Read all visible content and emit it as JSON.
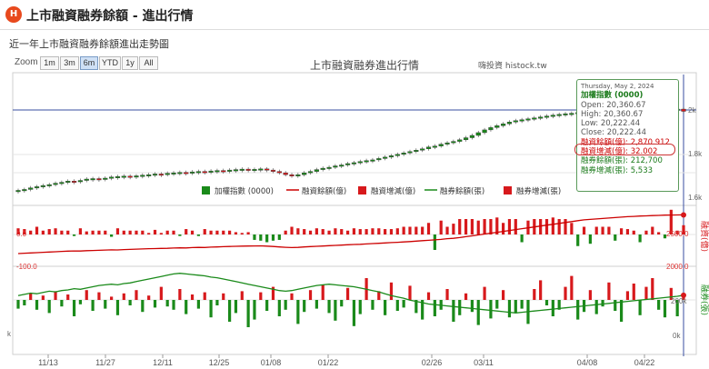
{
  "header": {
    "logo_text": "H",
    "title": "上市融資融券餘額 - 進出行情"
  },
  "subtitle": "近一年上市融資融券餘額進出走勢圖",
  "zoom": {
    "label": "Zoom",
    "buttons": [
      "1m",
      "3m",
      "6m",
      "YTD",
      "1y",
      "All"
    ],
    "active": "6m"
  },
  "chart_title": "上市融資融券進出行情",
  "credit": "嗨投資 histock.tw",
  "colors": {
    "up": "#d7191c",
    "down": "#1a8a1a",
    "margin_line": "#cc0000",
    "short_line": "#1a8a1a",
    "grid": "#e6e6e6",
    "axis": "#cfcfcf",
    "nav": "#3a4fa0"
  },
  "tooltip": {
    "date": "Thursday, May 2, 2024",
    "heading": "加權指數 (0000)",
    "rows": [
      {
        "label": "Open",
        "value": "20,360.67"
      },
      {
        "label": "High",
        "value": "20,360.67"
      },
      {
        "label": "Low",
        "value": "20,222.44"
      },
      {
        "label": "Close",
        "value": "20,222.44"
      }
    ],
    "stats": [
      {
        "label": "融資餘額(億)",
        "value": "2,870.912",
        "color": "red"
      },
      {
        "label": "融資增減(億)",
        "value": "32.002",
        "color": "red"
      },
      {
        "label": "融券餘額(張)",
        "value": "212,700",
        "color": "green"
      },
      {
        "label": "融券增減(張)",
        "value": "5,533",
        "color": "green"
      }
    ]
  },
  "chart_data": {
    "type": "candlestick",
    "x_labels": [
      "11/13",
      "11/27",
      "12/11",
      "12/25",
      "01/08",
      "01/22",
      "02/26",
      "03/11",
      "04/08",
      "04/22"
    ],
    "price_axis_labels": [
      "2k",
      "1.8k",
      "1.6k"
    ],
    "margin_axis_labels": [
      "0.0",
      "-100.0",
      "2500.0",
      "2000.0"
    ],
    "short_axis_labels": [
      "k",
      "200k",
      "0k"
    ],
    "right_axis_titles": [
      "融資(億)",
      "融券(張)"
    ],
    "legend": [
      {
        "name": "加權指數 (0000)",
        "kind": "square",
        "color": "#1a8a1a"
      },
      {
        "name": "融資餘額(億)",
        "kind": "line",
        "color": "#cc0000"
      },
      {
        "name": "融資增減(億)",
        "kind": "square",
        "color": "#d7191c"
      },
      {
        "name": "融券餘額(張)",
        "kind": "line",
        "color": "#1a8a1a"
      },
      {
        "name": "融券增減(張)",
        "kind": "square",
        "color": "#d7191c"
      }
    ],
    "index_close": [
      16800,
      16840,
      16910,
      16960,
      17010,
      17050,
      17110,
      17150,
      17200,
      17180,
      17230,
      17290,
      17310,
      17280,
      17330,
      17380,
      17400,
      17420,
      17390,
      17430,
      17460,
      17480,
      17510,
      17490,
      17540,
      17560,
      17580,
      17550,
      17600,
      17620,
      17610,
      17640,
      17660,
      17650,
      17680,
      17700,
      17720,
      17690,
      17710,
      17730,
      17680,
      17620,
      17560,
      17480,
      17420,
      17480,
      17560,
      17620,
      17700,
      17760,
      17800,
      17860,
      17900,
      17960,
      18000,
      18050,
      18090,
      18120,
      18180,
      18240,
      18300,
      18360,
      18420,
      18480,
      18540,
      18600,
      18680,
      18720,
      18800,
      18860,
      18920,
      18990,
      19080,
      19180,
      19300,
      19420,
      19520,
      19600,
      19680,
      19760,
      19820,
      19860,
      19900,
      19940,
      19980,
      20020,
      20060,
      20090,
      20120,
      20140,
      20170,
      20190,
      20210,
      20220,
      20240,
      20240,
      20250,
      20250,
      20260,
      20260,
      20262,
      20270,
      20280,
      20290,
      20300,
      20310,
      20320,
      20222.44
    ],
    "margin_balance": [
      2000,
      2008,
      2015,
      2020,
      2030,
      2035,
      2042,
      2050,
      2055,
      2060,
      2058,
      2066,
      2070,
      2075,
      2080,
      2085,
      2082,
      2090,
      2095,
      2100,
      2105,
      2110,
      2112,
      2118,
      2120,
      2125,
      2130,
      2128,
      2135,
      2140,
      2138,
      2145,
      2150,
      2155,
      2160,
      2165,
      2168,
      2170,
      2172,
      2175,
      2168,
      2160,
      2150,
      2142,
      2135,
      2140,
      2150,
      2158,
      2165,
      2170,
      2178,
      2185,
      2190,
      2198,
      2205,
      2210,
      2218,
      2225,
      2232,
      2240,
      2248,
      2255,
      2262,
      2270,
      2280,
      2290,
      2300,
      2310,
      2320,
      2335,
      2345,
      2360,
      2380,
      2400,
      2420,
      2440,
      2460,
      2480,
      2500,
      2520,
      2540,
      2560,
      2580,
      2600,
      2620,
      2640,
      2660,
      2680,
      2700,
      2720,
      2740,
      2760,
      2770,
      2780,
      2790,
      2800,
      2810,
      2820,
      2830,
      2838,
      2845,
      2850,
      2855,
      2860,
      2865,
      2868,
      2870,
      2870.912
    ],
    "margin_change": [
      8,
      7,
      5,
      10,
      5,
      7,
      8,
      5,
      5,
      -2,
      8,
      4,
      5,
      5,
      5,
      -3,
      8,
      5,
      5,
      5,
      5,
      2,
      6,
      2,
      5,
      5,
      -2,
      7,
      5,
      -2,
      7,
      5,
      5,
      5,
      5,
      3,
      2,
      3,
      -7,
      -8,
      -10,
      -8,
      -7,
      5,
      10,
      8,
      7,
      5,
      8,
      7,
      5,
      8,
      7,
      5,
      8,
      7,
      7,
      8,
      8,
      7,
      7,
      8,
      10,
      10,
      10,
      10,
      15,
      -20,
      18,
      10,
      14,
      20,
      20,
      20,
      18,
      20,
      20,
      22,
      15,
      20,
      20,
      -10,
      18,
      20,
      20,
      20,
      22,
      20,
      20,
      15,
      -15,
      10,
      -12,
      10,
      10,
      10,
      -8,
      8,
      7,
      5,
      -10,
      5,
      10,
      3,
      -5,
      32.002,
      5,
      12
    ],
    "short_balance": [
      212000,
      214000,
      216000,
      215000,
      217000,
      219000,
      218000,
      220000,
      221000,
      223000,
      222000,
      224000,
      226000,
      228000,
      229000,
      230000,
      229000,
      231000,
      232000,
      234000,
      236000,
      238000,
      240000,
      242000,
      244000,
      246000,
      247000,
      246000,
      245000,
      244000,
      243000,
      241000,
      240000,
      238000,
      236000,
      234000,
      232000,
      230000,
      228000,
      226000,
      224000,
      222000,
      220000,
      219000,
      220000,
      222000,
      224000,
      226000,
      228000,
      229000,
      230000,
      229000,
      228000,
      227000,
      226000,
      224000,
      222000,
      220000,
      218000,
      215000,
      212000,
      210000,
      208000,
      205000,
      203000,
      201000,
      199000,
      198000,
      197000,
      196000,
      195000,
      194000,
      193000,
      192000,
      191000,
      190000,
      189000,
      188000,
      187000,
      186000,
      185000,
      186000,
      187000,
      188000,
      189000,
      190000,
      191000,
      192000,
      193000,
      194000,
      195000,
      196000,
      197000,
      198000,
      199000,
      200000,
      201000,
      202000,
      203000,
      204000,
      205000,
      206000,
      207000,
      208000,
      209000,
      210000,
      211000,
      212700
    ],
    "short_change": [
      -8000,
      -5000,
      6000,
      -9000,
      4000,
      -12000,
      8000,
      -6000,
      5000,
      -15000,
      -4000,
      9000,
      -10000,
      7000,
      -8000,
      3000,
      -14000,
      6000,
      -5000,
      9000,
      -11000,
      4000,
      -7000,
      12000,
      -6000,
      -9000,
      10000,
      -13000,
      5000,
      -8000,
      7000,
      -16000,
      -5000,
      6000,
      -20000,
      -12000,
      8000,
      -25000,
      -18000,
      7000,
      -10000,
      12000,
      -15000,
      -9000,
      6000,
      -22000,
      -11000,
      9000,
      -8000,
      14000,
      -12000,
      -19000,
      -6000,
      11000,
      -24000,
      -13000,
      20000,
      -9000,
      8000,
      -14000,
      16000,
      -10000,
      -7000,
      13000,
      -12000,
      -18000,
      7000,
      -15000,
      -9000,
      10000,
      -20000,
      -14000,
      6000,
      -11000,
      -23000,
      12000,
      -17000,
      -8000,
      9000,
      -16000,
      -12000,
      -8000,
      -22000,
      10000,
      18000,
      -5000,
      -15000,
      -9000,
      12000,
      22000,
      -18000,
      -11000,
      9000,
      -13000,
      -6000,
      16000,
      -10000,
      -20000,
      8000,
      15000,
      -14000,
      12000,
      20000,
      -9000,
      -16000,
      11000,
      -15000,
      5533
    ]
  }
}
